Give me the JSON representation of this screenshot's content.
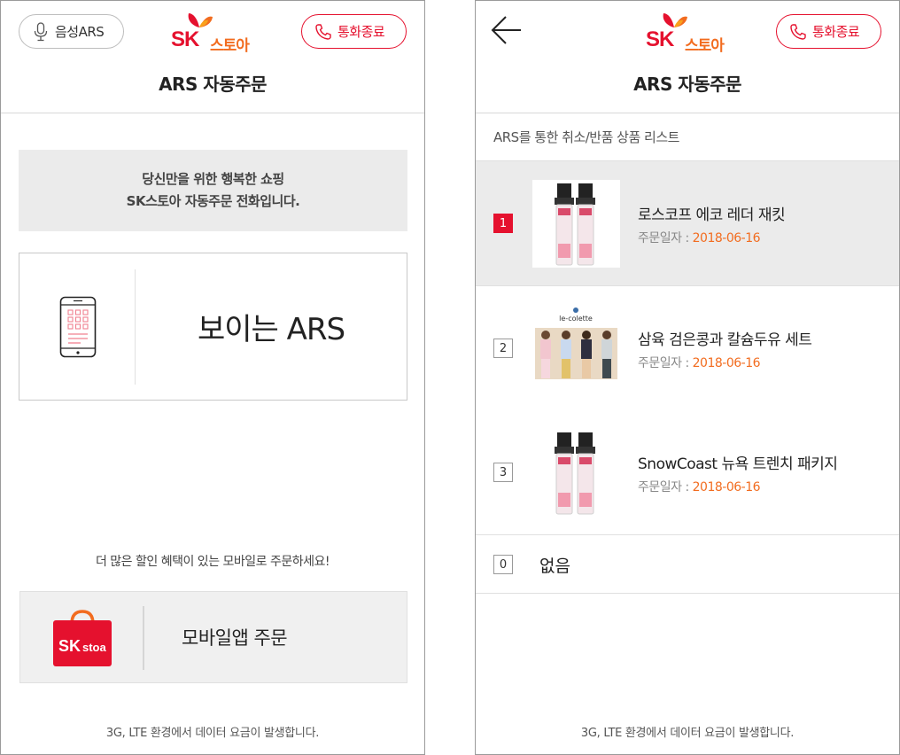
{
  "left": {
    "header": {
      "voice_label": "음성ARS",
      "end_call_label": "통화종료",
      "logo_sk": "SK",
      "logo_store": "스토아"
    },
    "title": "ARS 자동주문",
    "intro": {
      "line1": "당신만을 위한 행복한 쇼핑",
      "line2": "SK스토아 자동주문 전화입니다."
    },
    "ars_card_label": "보이는 ARS",
    "promo_text": "더 많은 할인 혜택이 있는 모바일로 주문하세요!",
    "app_card": {
      "icon_text_sk": "SK",
      "icon_text_stoa": "stoa",
      "label": "모바일앱 주문"
    },
    "footer_note": "3G, LTE 환경에서 데이터 요금이 발생합니다."
  },
  "right": {
    "header": {
      "end_call_label": "통화종료",
      "logo_sk": "SK",
      "logo_store": "스토아"
    },
    "title": "ARS 자동주문",
    "list_caption": "ARS를 통한 취소/반품 상품 리스트",
    "items": [
      {
        "num": "1",
        "name": "로스코프 에코 레더 재킷",
        "date_label": "주문일자 : ",
        "date": "2018-06-16",
        "selected": true,
        "thumb_brand": ""
      },
      {
        "num": "2",
        "name": "삼육 검은콩과 칼슘두유 세트",
        "date_label": "주문일자 : ",
        "date": "2018-06-16",
        "selected": false,
        "thumb_brand": "le-colette"
      },
      {
        "num": "3",
        "name": "SnowCoast 뉴욕 트렌치 패키지",
        "date_label": "주문일자 : ",
        "date": "2018-06-16",
        "selected": false,
        "thumb_brand": ""
      }
    ],
    "none_option": {
      "num": "0",
      "label": "없음"
    },
    "footer_note": "3G, LTE 환경에서 데이터 요금이 발생합니다."
  },
  "colors": {
    "brand_red": "#e5112e",
    "brand_orange": "#f26c1f",
    "selected_bg": "#ebebeb"
  },
  "icons": [
    "mic-icon",
    "phone-icon",
    "back-arrow-icon",
    "smartphone-keypad-icon",
    "sk-stoa-app-icon"
  ]
}
